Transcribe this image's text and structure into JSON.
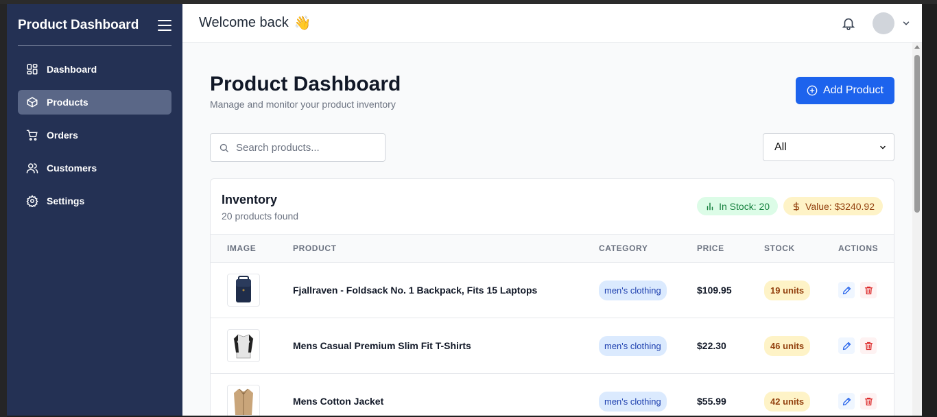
{
  "sidebar": {
    "title": "Product Dashboard",
    "items": [
      {
        "label": "Dashboard",
        "icon": "grid-icon",
        "active": false
      },
      {
        "label": "Products",
        "icon": "box-icon",
        "active": true
      },
      {
        "label": "Orders",
        "icon": "cart-icon",
        "active": false
      },
      {
        "label": "Customers",
        "icon": "users-icon",
        "active": false
      },
      {
        "label": "Settings",
        "icon": "gear-icon",
        "active": false
      }
    ]
  },
  "topbar": {
    "welcome": "Welcome back",
    "wave": "👋"
  },
  "page": {
    "title": "Product Dashboard",
    "subtitle": "Manage and monitor your product inventory",
    "add_button": "Add Product"
  },
  "filters": {
    "search_placeholder": "Search products...",
    "category_selected": "All"
  },
  "inventory": {
    "title": "Inventory",
    "count_text": "20 products found",
    "in_stock_badge": "In Stock: 20",
    "value_badge": "Value: $3240.92",
    "columns": [
      "IMAGE",
      "PRODUCT",
      "CATEGORY",
      "PRICE",
      "STOCK",
      "ACTIONS"
    ],
    "rows": [
      {
        "name": "Fjallraven - Foldsack No. 1 Backpack, Fits 15 Laptops",
        "category": "men's clothing",
        "price": "$109.95",
        "stock": "19 units",
        "image": "backpack"
      },
      {
        "name": "Mens Casual Premium Slim Fit T-Shirts",
        "category": "men's clothing",
        "price": "$22.30",
        "stock": "46 units",
        "image": "tshirt"
      },
      {
        "name": "Mens Cotton Jacket",
        "category": "men's clothing",
        "price": "$55.99",
        "stock": "42 units",
        "image": "jacket"
      }
    ]
  },
  "colors": {
    "sidebar_bg": "#243154",
    "accent": "#1d63ed",
    "active_nav": "#5a6787"
  }
}
